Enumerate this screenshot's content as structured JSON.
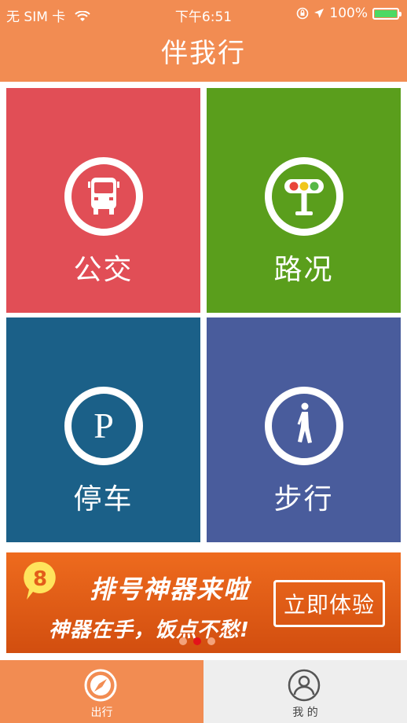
{
  "status_bar": {
    "carrier": "无 SIM 卡",
    "time": "下午6:51",
    "battery_text": "100%",
    "battery_level": 1.0
  },
  "app": {
    "title": "伴我行"
  },
  "tiles": [
    {
      "label": "公交",
      "icon": "bus-icon",
      "color": "#E14E56"
    },
    {
      "label": "路况",
      "icon": "traffic-light-icon",
      "color": "#5A9E1C"
    },
    {
      "label": "停车",
      "icon": "parking-icon",
      "color": "#1B6088"
    },
    {
      "label": "步行",
      "icon": "walking-icon",
      "color": "#495C9C"
    }
  ],
  "banner": {
    "badge": "8",
    "title": "排号神器来啦",
    "subtitle": "神器在手，饭点不愁!",
    "button": "立即体验",
    "page_count": 3,
    "active_page": 2
  },
  "tabbar": {
    "items": [
      {
        "label": "出行",
        "icon": "compass-icon",
        "active": true
      },
      {
        "label": "我 的",
        "icon": "user-icon",
        "active": false
      }
    ]
  },
  "colors": {
    "accent": "#F28C52"
  }
}
